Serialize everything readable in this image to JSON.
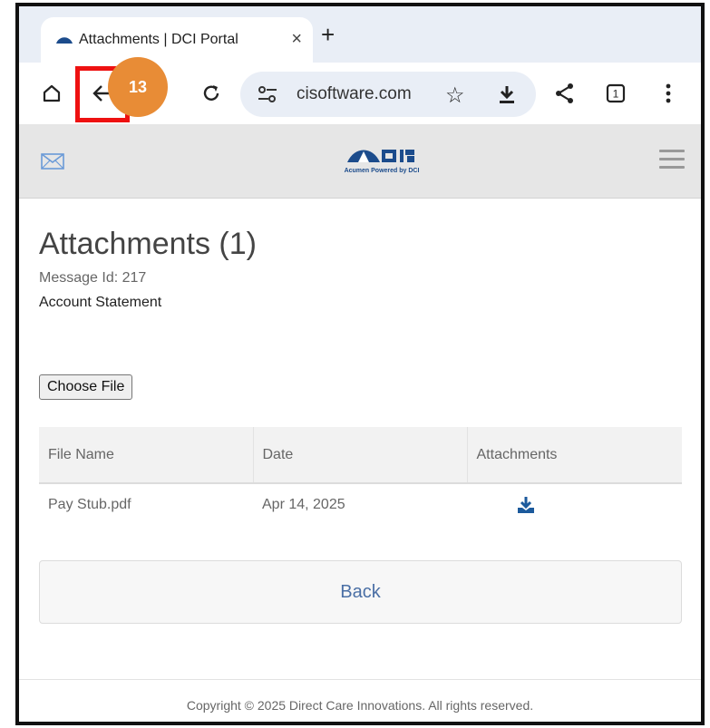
{
  "browser": {
    "tab_title": "Attachments | DCI Portal",
    "tab_close": "×",
    "new_tab": "+",
    "url": "cisoftware.com",
    "tab_count": "1",
    "step_number": "13"
  },
  "icons": [
    "home-icon",
    "back-arrow-icon",
    "forward-arrow-icon",
    "reload-icon",
    "site-settings-icon",
    "star-icon",
    "download-icon",
    "share-icon",
    "tab-switcher-icon",
    "more-menu-icon",
    "mail-icon",
    "hamburger-menu-icon",
    "file-download-icon"
  ],
  "header": {
    "logo_tagline": "Acumen Powered by DCI"
  },
  "page": {
    "title": "Attachments (1)",
    "message_id": "Message Id: 217",
    "subject": "Account Statement",
    "choose_file_label": "Choose File"
  },
  "table": {
    "headers": [
      "File Name",
      "Date",
      "Attachments"
    ],
    "rows": [
      {
        "file_name": "Pay Stub.pdf",
        "date": "Apr 14, 2025"
      }
    ]
  },
  "back_label": "Back",
  "footer": {
    "copyright": "Copyright © 2025 Direct Care Innovations. All rights reserved."
  },
  "colors": {
    "highlight": "#ee1111",
    "badge": "#e88c36",
    "brand_blue": "#1c4c8c",
    "link_blue": "#4a6fa5"
  }
}
